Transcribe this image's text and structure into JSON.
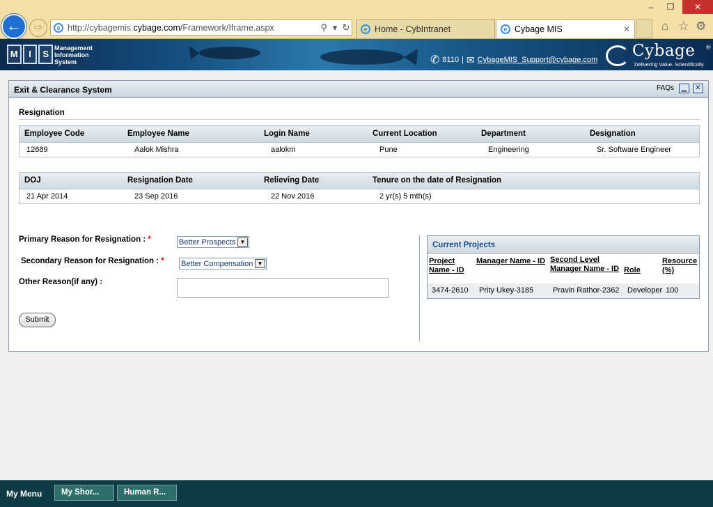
{
  "browser": {
    "window_min": "‒",
    "window_max": "❐",
    "window_close": "✕",
    "back_icon": "←",
    "forward_icon": "⇨",
    "address_prefix": "http://cybagemis.",
    "address_domain": "cybage.com",
    "address_suffix": "/Framework/Iframe.aspx",
    "tabs": [
      {
        "label": "Home - CybIntranet"
      },
      {
        "label": "Cybage MIS"
      }
    ],
    "tab_close": "✕",
    "home_icon": "⌂",
    "star_icon": "☆",
    "gear_icon": "⚙"
  },
  "header": {
    "mis_letters": [
      "M",
      "I",
      "S"
    ],
    "mis_line1": "Management",
    "mis_line2": "Information",
    "mis_line3": "System",
    "phone_icon": "✆",
    "phone_ext": "8110",
    "separator": "|",
    "mail_icon": "✉",
    "support_email": "CybageMIS_Support@cybage.com",
    "brand": "Cybage",
    "brand_reg": "®",
    "tagline": "Delivering Value. Scientifically."
  },
  "panel": {
    "title": "Exit & Clearance System",
    "faqs": "FAQs",
    "min_icon": "▁",
    "close_icon": "✕",
    "section_title": "Resignation",
    "table1": {
      "headers": [
        "Employee Code",
        "Employee Name",
        "Login Name",
        "Current Location",
        "Department",
        "Designation"
      ],
      "values": [
        "12689",
        "Aalok Mishra",
        "aalokm",
        "Pune",
        "Engineering",
        "Sr. Software Engineer"
      ]
    },
    "table2": {
      "headers": [
        "DOJ",
        "Resignation Date",
        "Relieving Date",
        "Tenure on the date of Resignation"
      ],
      "values": [
        "21 Apr 2014",
        "23 Sep 2016",
        "22 Nov 2016",
        "2 yr(s) 5 mth(s)"
      ]
    },
    "form": {
      "primary_label": "Primary Reason for Resignation :",
      "primary_value": "Better Prospects",
      "secondary_label": "Secondary Reason for Resignation :",
      "secondary_value": "Better Compensation",
      "required_mark": "*",
      "other_label": "Other Reason(if any) :",
      "other_value": "",
      "dropdown_icon": "▼",
      "submit_label": "Submit"
    },
    "projects": {
      "title": "Current Projects",
      "headers": [
        "Project Name - ID",
        "Manager Name - ID",
        "Second Level Manager Name - ID",
        "Role",
        "Resource (%)"
      ],
      "rows": [
        [
          "3474-2610",
          "Prity Ukey-3185",
          "Pravin Rathor-2362",
          "Developer",
          "100"
        ]
      ]
    }
  },
  "taskbar": {
    "menu_label": "My Menu",
    "items": [
      {
        "label": "My Shor..."
      },
      {
        "label": "Human R..."
      }
    ]
  },
  "colors": {
    "browser_chrome": "#f4dfa6",
    "banner_blue": "#164e7e",
    "taskbar": "#0c3b44",
    "required": "#dd0000",
    "projects_title": "#1b4c8a"
  }
}
